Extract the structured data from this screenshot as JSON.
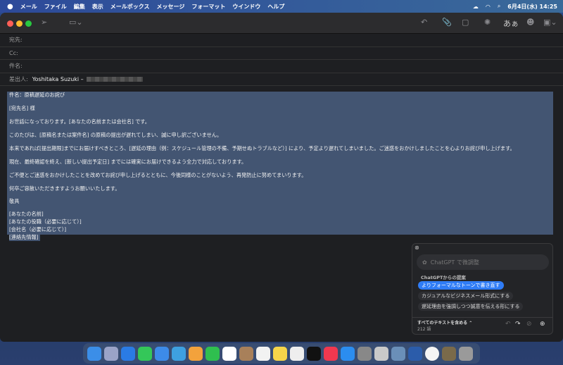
{
  "menubar": {
    "items": [
      "メール",
      "ファイル",
      "編集",
      "表示",
      "メールボックス",
      "メッセージ",
      "フォーマット",
      "ウインドウ",
      "ヘルプ"
    ],
    "clock": "6月4日(水) 14:25"
  },
  "toolbar": {
    "font_button": "あぁ"
  },
  "header": {
    "to_label": "宛先:",
    "cc_label": "Cc:",
    "subject_label": "件名:",
    "from_label": "差出人:",
    "from_value": "Yoshitaka Suzuki –"
  },
  "body": {
    "lines": [
      "件名：原稿遅延のお詫び",
      "[宛先名] 様",
      "お世話になっております。[あなたの名前または会社名] です。",
      "このたびは、[原稿名または案件名] の原稿の提出が遅れてしまい、誠に申し訳ございません。",
      "本来であれば[提出期限]までにお届けすべきところ、[遅延の理由（例：スケジュール管理の不備、予期せぬトラブルなど）] により、予定より遅れてしまいました。ご迷惑をおかけしましたことを心よりお詫び申し上げます。",
      "現在、最終確認を終え、[新しい提出予定日] までには確実にお届けできるよう全力で対応しております。",
      "ご不便とご迷惑をおかけしたことを改めてお詫び申し上げるとともに、今後同様のことがないよう、再発防止に努めてまいります。",
      "何卒ご容赦いただきますようお願いいたします。",
      "敬具",
      "[あなたの名前]",
      "[あなたの役職（必要に応じて）]",
      "[会社名（必要に応じて）]",
      "[連絡先情報]"
    ]
  },
  "chatgpt_panel": {
    "input_placeholder": "ChatGPT で微調整",
    "suggestions_title": "ChatGPTからの提案",
    "suggestions": [
      "よりフォーマルなトーンで書き直す",
      "カジュアルなビジネスメール形式にする",
      "遅延理由を強調しつつ誠意を伝える形にする"
    ],
    "scope": "すべてのテキストを含める ⌃",
    "word_count": "212 語",
    "accent": "#2f7cf6"
  },
  "colors": {
    "selection": "#435572"
  }
}
